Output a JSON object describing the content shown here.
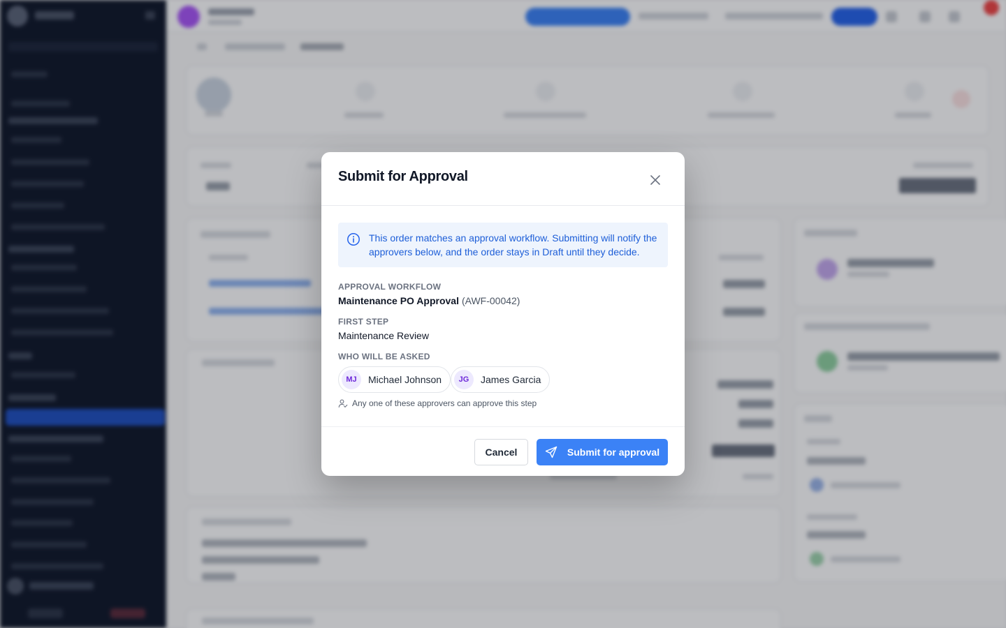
{
  "modal": {
    "title": "Submit for Approval",
    "info_text": "This order matches an approval workflow. Submitting will notify the approvers below, and the order stays in Draft until they decide.",
    "workflow_label": "APPROVAL WORKFLOW",
    "workflow_name": "Maintenance PO Approval",
    "workflow_code": "(AWF-00042)",
    "first_step_label": "FIRST STEP",
    "first_step_value": "Maintenance Review",
    "approvers_label": "WHO WILL BE ASKED",
    "approvers": [
      {
        "initials": "MJ",
        "name": "Michael Johnson"
      },
      {
        "initials": "JG",
        "name": "James Garcia"
      }
    ],
    "hint": "Any one of these approvers can approve this step",
    "cancel_label": "Cancel",
    "submit_label": "Submit for approval"
  },
  "colors": {
    "primary": "#3b82f6",
    "info_bg": "#eef4fd",
    "info_text": "#1d5ed8",
    "avatar_bg": "#ede9fe",
    "avatar_text": "#6d28d9",
    "sidebar_bg": "#0f1729"
  },
  "icons": {
    "close": "close-icon",
    "info": "info-icon",
    "approver_hint": "user-check-icon",
    "submit": "send-icon"
  }
}
